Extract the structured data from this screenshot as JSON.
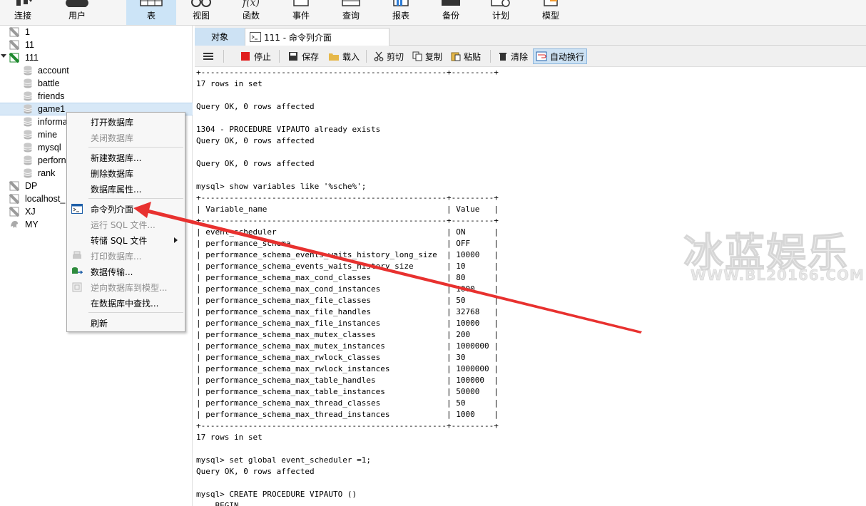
{
  "toolbar": {
    "connect": "连接",
    "user": "用户",
    "table": "表",
    "view": "视图",
    "function": "函数",
    "event": "事件",
    "query": "查询",
    "report": "报表",
    "backup": "备份",
    "schedule": "计划",
    "model": "模型",
    "function_icon_text": "f(x)"
  },
  "tree": {
    "items": [
      {
        "label": "1",
        "kind": "connection"
      },
      {
        "label": "11",
        "kind": "connection"
      },
      {
        "label": "111",
        "kind": "connection-open"
      },
      {
        "label": "account",
        "kind": "database"
      },
      {
        "label": "battle",
        "kind": "database"
      },
      {
        "label": "friends",
        "kind": "database"
      },
      {
        "label": "game1",
        "kind": "database"
      },
      {
        "label": "informa",
        "kind": "database"
      },
      {
        "label": "mine",
        "kind": "database"
      },
      {
        "label": "mysql",
        "kind": "database"
      },
      {
        "label": "perforn",
        "kind": "database"
      },
      {
        "label": "rank",
        "kind": "database"
      },
      {
        "label": "DP",
        "kind": "connection"
      },
      {
        "label": "localhost_",
        "kind": "connection"
      },
      {
        "label": "XJ",
        "kind": "connection"
      },
      {
        "label": "MY",
        "kind": "connection-mysql"
      }
    ]
  },
  "context_menu": {
    "open_db": "打开数据库",
    "close_db": "关闭数据库",
    "new_db": "新建数据库...",
    "delete_db": "删除数据库",
    "db_props": "数据库属性...",
    "cmd_console": "命令列介面",
    "run_sql": "运行 SQL 文件...",
    "dump_sql": "转储 SQL 文件",
    "print_db": "打印数据库...",
    "data_transfer": "数据传输...",
    "reverse_model": "逆向数据库到模型...",
    "find_in_db": "在数据库中查找...",
    "refresh": "刷新"
  },
  "tabs": {
    "objects": "对象",
    "console": "111 - 命令列介面"
  },
  "console_toolbar": {
    "stop": "停止",
    "save": "保存",
    "load": "载入",
    "cut": "剪切",
    "copy": "复制",
    "paste": "粘贴",
    "clear": "清除",
    "word_wrap": "自动换行"
  },
  "console_lines": [
    "+----------------------------------------------------+---------+",
    "17 rows in set",
    "",
    "Query OK, 0 rows affected",
    "",
    "1304 - PROCEDURE VIPAUTO already exists",
    "Query OK, 0 rows affected",
    "",
    "Query OK, 0 rows affected",
    "",
    "mysql> show variables like '%sche%';",
    "+----------------------------------------------------+---------+",
    "| Variable_name                                      | Value   |",
    "+----------------------------------------------------+---------+",
    "| event_scheduler                                    | ON      |",
    "| performance_schema                                 | OFF     |",
    "| performance_schema_events_waits_history_long_size  | 10000   |",
    "| performance_schema_events_waits_history_size       | 10      |",
    "| performance_schema_max_cond_classes                | 80      |",
    "| performance_schema_max_cond_instances              | 1000    |",
    "| performance_schema_max_file_classes                | 50      |",
    "| performance_schema_max_file_handles                | 32768   |",
    "| performance_schema_max_file_instances              | 10000   |",
    "| performance_schema_max_mutex_classes               | 200     |",
    "| performance_schema_max_mutex_instances             | 1000000 |",
    "| performance_schema_max_rwlock_classes              | 30      |",
    "| performance_schema_max_rwlock_instances            | 1000000 |",
    "| performance_schema_max_table_handles               | 100000  |",
    "| performance_schema_max_table_instances             | 50000   |",
    "| performance_schema_max_thread_classes              | 50      |",
    "| performance_schema_max_thread_instances            | 1000    |",
    "+----------------------------------------------------+---------+",
    "17 rows in set",
    "",
    "mysql> set global event_scheduler =1;",
    "Query OK, 0 rows affected",
    "",
    "mysql> CREATE PROCEDURE VIPAUTO ()",
    "    BEGIN"
  ],
  "watermark": {
    "title": "冰蓝娱乐",
    "url": "WWW.BL20166.COM"
  },
  "colors": {
    "accent": "#cde2f4",
    "arrow": "#e8312f",
    "connection_green": "#1e8a2e"
  }
}
